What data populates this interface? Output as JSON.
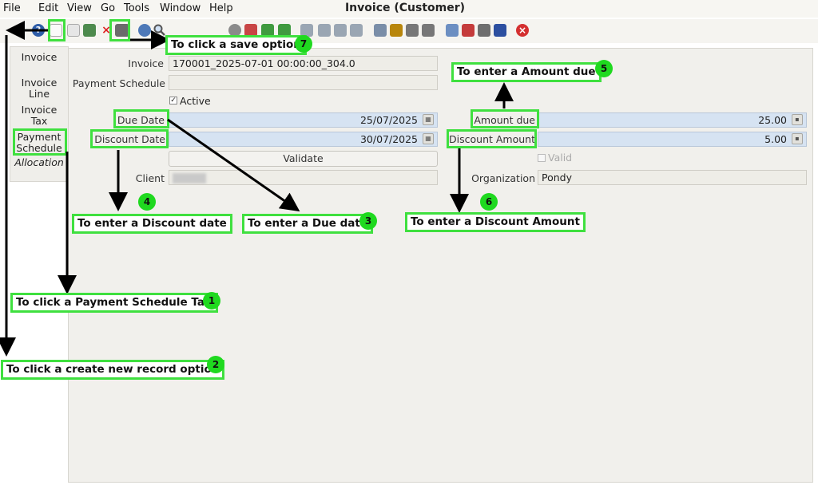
{
  "window_title": "Invoice (Customer)",
  "menu": [
    "File",
    "Edit",
    "View",
    "Go",
    "Tools",
    "Window",
    "Help"
  ],
  "toolbar_icons": [
    "undo-icon",
    "help-icon",
    "new-record-icon",
    "copy-record-icon",
    "archive-icon",
    "delete-icon",
    "save-icon",
    "refresh-icon",
    "find-icon",
    "attachment-icon",
    "chat-icon",
    "grid-toggle-icon",
    "history-icon",
    "home-icon",
    "back-icon",
    "forward-icon",
    "first-record-icon",
    "previous-record-icon",
    "next-record-icon",
    "last-record-icon",
    "report-icon",
    "archived-docs-icon",
    "print-preview-icon",
    "print-icon",
    "zoom-across-icon",
    "workflow-icon",
    "product-info-icon",
    "lock-icon",
    "close-window-icon"
  ],
  "tabs": {
    "invoice": "Invoice",
    "invoice_line_1": "Invoice",
    "invoice_line_2": "Line",
    "invoice_tax_1": "Invoice",
    "invoice_tax_2": "Tax",
    "payment_schedule_1": "Payment",
    "payment_schedule_2": "Schedule",
    "allocation": "Allocation"
  },
  "form": {
    "invoice_label": "Invoice",
    "invoice_value": "170001_2025-07-01 00:00:00_304.0",
    "payment_schedule_label": "Payment Schedule",
    "payment_schedule_value": "",
    "active_label": "Active",
    "due_date_label": "Due Date",
    "due_date_value": "25/07/2025",
    "discount_date_label": "Discount Date",
    "discount_date_value": "30/07/2025",
    "validate_label": "Validate",
    "client_label": "Client",
    "client_value": "",
    "amount_due_label": "Amount due",
    "amount_due_value": "25.00",
    "discount_amount_label": "Discount Amount",
    "discount_amount_value": "5.00",
    "valid_label": "Valid",
    "organization_label": "Organization",
    "organization_value": "Pondy"
  },
  "annotations": {
    "a1": "To click a Payment Schedule Tab",
    "a2": "To click a create new record option",
    "a3": "To enter a Due date",
    "a4": "To enter a Discount date",
    "a5": "To enter a Amount due",
    "a6": "To enter a Discount Amount",
    "a7": "To click a save option",
    "n1": "1",
    "n2": "2",
    "n3": "3",
    "n4": "4",
    "n5": "5",
    "n6": "6",
    "n7": "7"
  },
  "colors": {
    "highlight": "#3fe03f",
    "badge": "#1fd91f",
    "field_mandatory": "#d6e3f2"
  }
}
